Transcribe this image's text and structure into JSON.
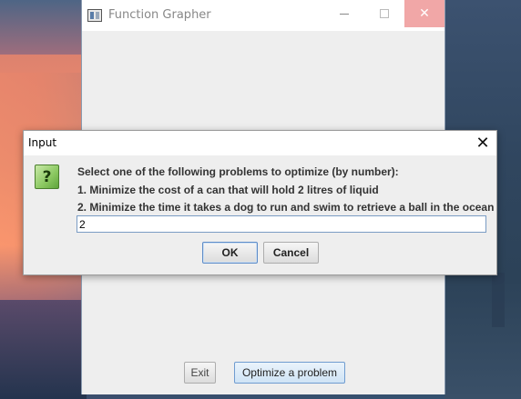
{
  "main_window": {
    "title": "Function Grapher",
    "buttons": {
      "exit_label": "Exit",
      "optimize_label": "Optimize a problem"
    }
  },
  "dialog": {
    "title": "Input",
    "icon": "question-icon",
    "icon_glyph": "?",
    "close_glyph": "✕",
    "message_lines": [
      "Select one of the following problems to optimize (by number):",
      "1. Minimize the cost of a can that will hold 2 litres of liquid",
      "2. Minimize the time it takes a dog to run and swim to retrieve a ball in the ocean"
    ],
    "input_value": "2",
    "ok_label": "OK",
    "cancel_label": "Cancel"
  },
  "colors": {
    "accent_border": "#6f9cd0",
    "close_hover": "#f1a7a7",
    "question_icon": "#8ac760"
  }
}
